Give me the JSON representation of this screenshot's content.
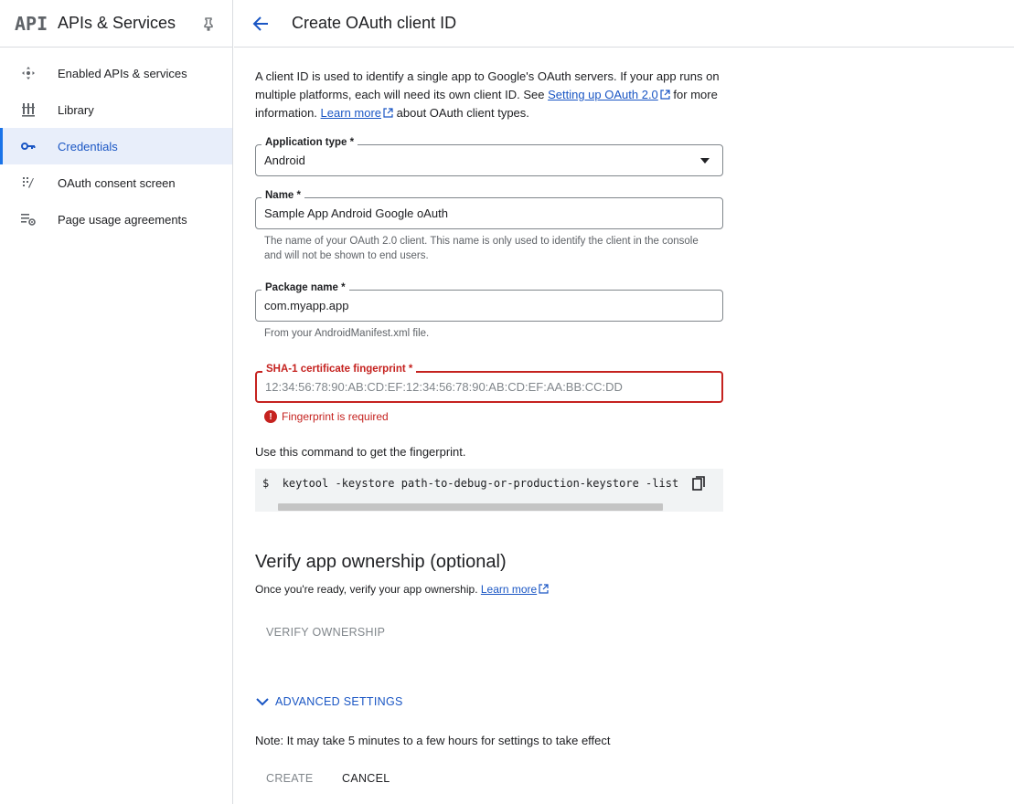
{
  "sidebar": {
    "logo": "API",
    "title": "APIs & Services",
    "items": [
      {
        "label": "Enabled APIs & services",
        "icon": "enabled-apis-icon"
      },
      {
        "label": "Library",
        "icon": "library-icon"
      },
      {
        "label": "Credentials",
        "icon": "key-icon",
        "active": true
      },
      {
        "label": "OAuth consent screen",
        "icon": "consent-screen-icon"
      },
      {
        "label": "Page usage agreements",
        "icon": "settings-list-icon"
      }
    ]
  },
  "header": {
    "title": "Create OAuth client ID"
  },
  "intro": {
    "part1": "A client ID is used to identify a single app to Google's OAuth servers. If your app runs on multiple platforms, each will need its own client ID. See ",
    "link1": "Setting up OAuth 2.0",
    "part2": " for more information. ",
    "link2": "Learn more",
    "part3": " about OAuth client types."
  },
  "form": {
    "app_type": {
      "label": "Application type *",
      "value": "Android"
    },
    "name": {
      "label": "Name *",
      "value": "Sample App Android Google oAuth",
      "hint": "The name of your OAuth 2.0 client. This name is only used to identify the client in the console and will not be shown to end users."
    },
    "package": {
      "label": "Package name *",
      "value": "com.myapp.app",
      "hint": "From your AndroidManifest.xml file."
    },
    "sha1": {
      "label": "SHA-1 certificate fingerprint *",
      "placeholder": "12:34:56:78:90:AB:CD:EF:12:34:56:78:90:AB:CD:EF:AA:BB:CC:DD",
      "error": "Fingerprint is required"
    }
  },
  "command": {
    "label": "Use this command to get the fingerprint.",
    "prompt": "$",
    "text": "keytool -keystore path-to-debug-or-production-keystore -list"
  },
  "verify": {
    "heading": "Verify app ownership (optional)",
    "text": "Once you're ready, verify your app ownership. ",
    "link": "Learn more",
    "button": "VERIFY OWNERSHIP"
  },
  "advanced": {
    "label": "ADVANCED SETTINGS"
  },
  "note": "Note: It may take 5 minutes to a few hours for settings to take effect",
  "actions": {
    "create": "CREATE",
    "cancel": "CANCEL"
  },
  "colors": {
    "accent": "#1a73e8",
    "error": "#c5221f",
    "active_bg": "#e8eefa"
  }
}
